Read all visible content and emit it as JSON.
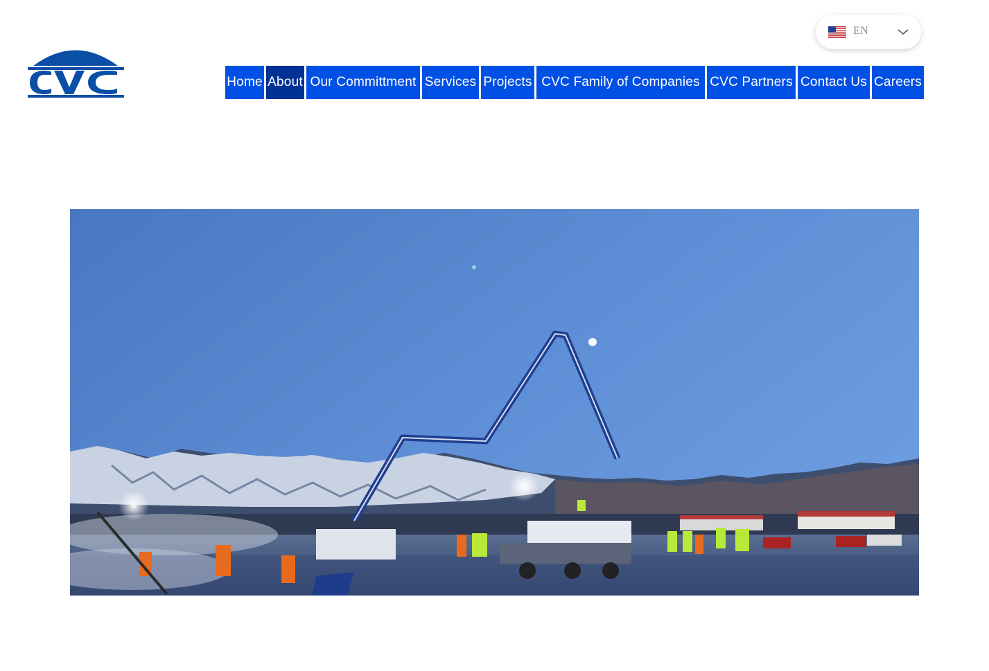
{
  "header": {
    "logo_text": "CVC",
    "brand_color": "#0a4ea6",
    "language": {
      "code": "EN",
      "flag_icon": "us-flag-icon",
      "toggle_icon": "chevron-down-icon"
    },
    "nav": {
      "accent": "#0050e6",
      "active_color": "#003296",
      "items": [
        {
          "label": "Home",
          "active": false
        },
        {
          "label": "About",
          "active": true
        },
        {
          "label": "Our Committment",
          "active": false
        },
        {
          "label": "Services",
          "active": false
        },
        {
          "label": "Projects",
          "active": false
        },
        {
          "label": "CVC Family of Companies",
          "active": false
        },
        {
          "label": "CVC Partners",
          "active": false
        },
        {
          "label": "Contact Us",
          "active": false
        },
        {
          "label": "Careers",
          "active": false
        }
      ]
    }
  },
  "main": {
    "hero_image": "concrete-pour-construction-site-photo"
  }
}
